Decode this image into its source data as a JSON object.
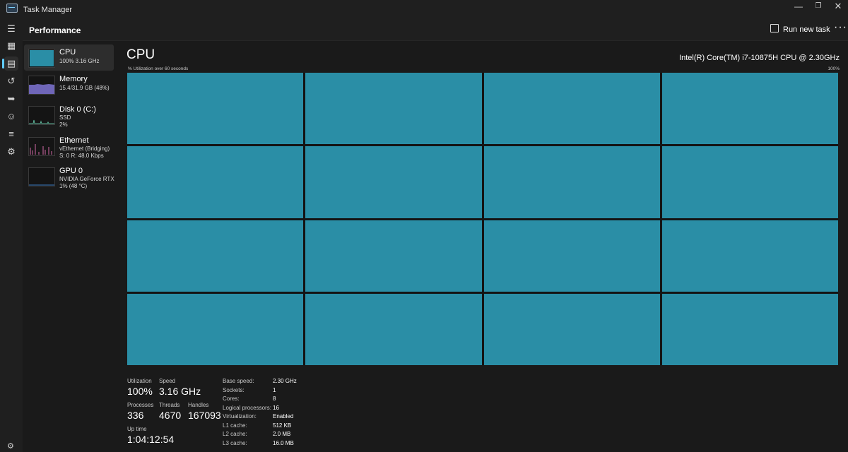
{
  "window": {
    "title": "Task Manager"
  },
  "rail": {
    "icons": [
      "menu-icon",
      "processes-icon",
      "performance-icon",
      "app-history-icon",
      "startup-icon",
      "users-icon",
      "details-icon",
      "services-icon",
      "settings-icon"
    ]
  },
  "header": {
    "title": "Performance",
    "run_new_task": "Run new task",
    "more": "···"
  },
  "sidebar": {
    "items": [
      {
        "name": "CPU",
        "sub1": "100%  3.16 GHz",
        "sub2": "",
        "thumb_color": "#2a8ea6"
      },
      {
        "name": "Memory",
        "sub1": "15.4/31.9 GB (48%)",
        "sub2": "",
        "thumb_color": "#8a7fd6"
      },
      {
        "name": "Disk 0 (C:)",
        "sub1": "SSD",
        "sub2": "2%",
        "thumb_color": "#5fb59a"
      },
      {
        "name": "Ethernet",
        "sub1": "vEthernet (Bridging)",
        "sub2": "S: 0  R: 48.0 Kbps",
        "thumb_color": "#d36aa9"
      },
      {
        "name": "GPU 0",
        "sub1": "NVIDIA GeForce RTX ...",
        "sub2": "1%  (48 °C)",
        "thumb_color": "#3a7ac0"
      }
    ]
  },
  "main": {
    "heading": "CPU",
    "model": "Intel(R) Core(TM) i7-10875H CPU @ 2.30GHz",
    "graph_caption": "% Utilization over 60 seconds",
    "graph_max": "100%",
    "graph_color": "#2a8ea6",
    "core_graphs": 16,
    "core_utilization": [
      100,
      100,
      100,
      100,
      100,
      100,
      100,
      100,
      100,
      100,
      100,
      100,
      100,
      100,
      100,
      100
    ]
  },
  "stats": {
    "utilization_label": "Utilization",
    "utilization": "100%",
    "speed_label": "Speed",
    "speed": "3.16 GHz",
    "processes_label": "Processes",
    "processes": "336",
    "threads_label": "Threads",
    "threads": "4670",
    "handles_label": "Handles",
    "handles": "167093",
    "uptime_label": "Up time",
    "uptime": "1:04:12:54"
  },
  "specs": [
    {
      "label": "Base speed:",
      "value": "2.30 GHz"
    },
    {
      "label": "Sockets:",
      "value": "1"
    },
    {
      "label": "Cores:",
      "value": "8"
    },
    {
      "label": "Logical processors:",
      "value": "16"
    },
    {
      "label": "Virtualization:",
      "value": "Enabled"
    },
    {
      "label": "L1 cache:",
      "value": "512 KB"
    },
    {
      "label": "L2 cache:",
      "value": "2.0 MB"
    },
    {
      "label": "L3 cache:",
      "value": "16.0 MB"
    }
  ]
}
